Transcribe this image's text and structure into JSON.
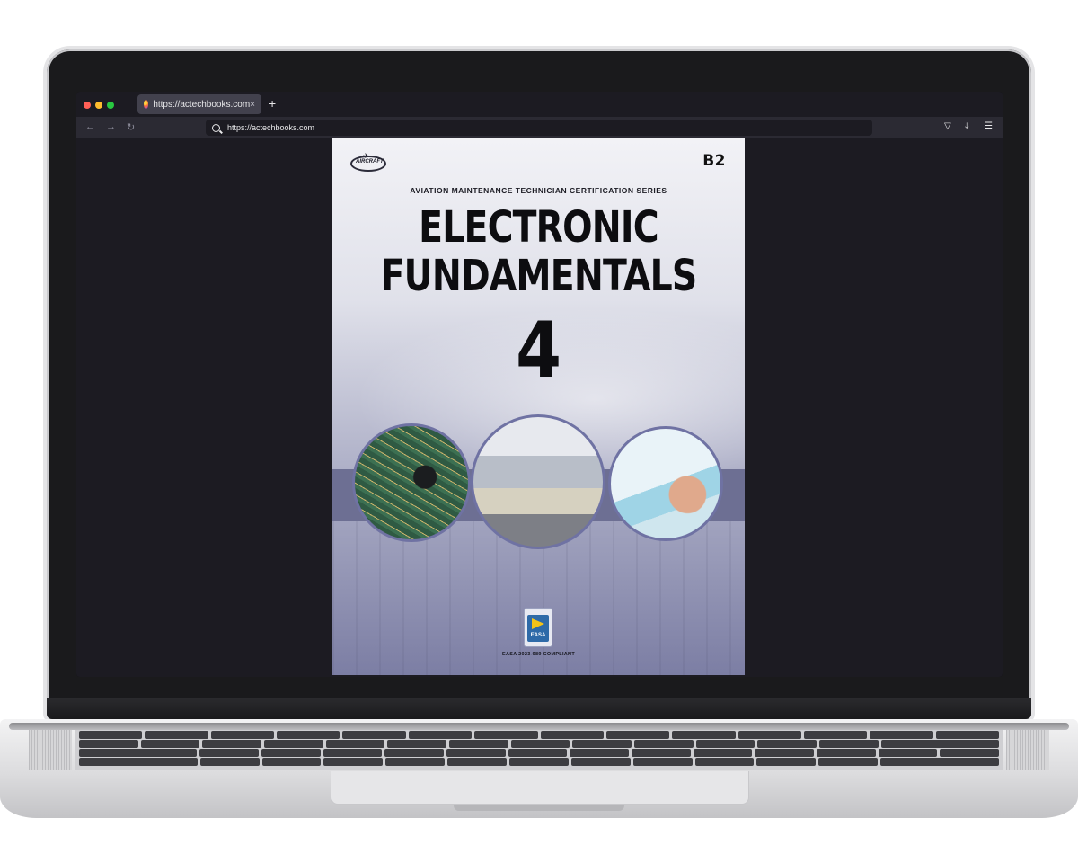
{
  "browser": {
    "tab_title": "https://actechbooks.com",
    "url": "https://actechbooks.com",
    "new_tab": "+",
    "close_tab": "×"
  },
  "cover": {
    "grade": "B2",
    "series": "AVIATION MAINTENANCE TECHNICIAN CERTIFICATION SERIES",
    "title_line1": "ELECTRONIC",
    "title_line2": "FUNDAMENTALS",
    "module_number": "4",
    "logo_text": "AIRCRAFT",
    "easa_badge": "EASA",
    "compliance": "EASA 2023-989 COMPLIANT"
  },
  "colors": {
    "browser_chrome": "#1c1b22",
    "navbar": "#2b2a33",
    "cover_accent": "#6d6f93"
  },
  "icons": [
    "firefox-favicon",
    "back-icon",
    "forward-icon",
    "reload-icon",
    "search-icon",
    "pocket-icon",
    "download-icon",
    "menu-icon"
  ]
}
